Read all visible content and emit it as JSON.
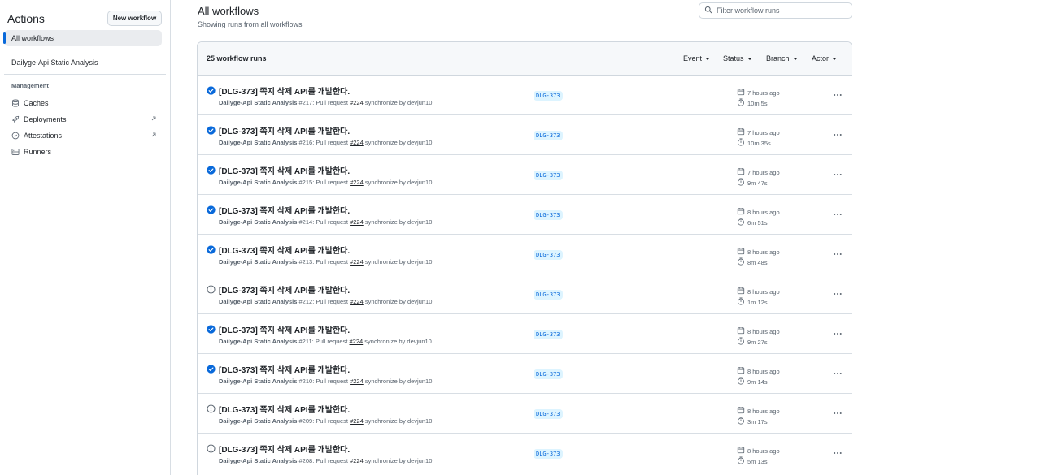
{
  "sidebar": {
    "title": "Actions",
    "new_workflow_label": "New workflow",
    "all_workflows_label": "All workflows",
    "workflow_item_label": "Dailyge-Api Static Analysis",
    "section_label": "Management",
    "management_items": [
      {
        "label": "Caches",
        "icon": "database-icon"
      },
      {
        "label": "Deployments",
        "icon": "rocket-icon",
        "external": true
      },
      {
        "label": "Attestations",
        "icon": "verified-icon",
        "external": true
      },
      {
        "label": "Runners",
        "icon": "server-icon"
      }
    ]
  },
  "main": {
    "title": "All workflows",
    "subtitle": "Showing runs from all workflows",
    "filter_placeholder": "Filter workflow runs"
  },
  "table": {
    "count_label": "25 workflow runs",
    "filters": [
      "Event",
      "Status",
      "Branch",
      "Actor"
    ]
  },
  "runs": [
    {
      "status": "success",
      "title": "[DLG-373] 쪽지 삭제 API를 개발한다.",
      "workflow": "Dailyge-Api Static Analysis",
      "run_no": "#217",
      "pr_prefix": ": Pull request ",
      "pr": "#224",
      "suffix": " synchronize by devjun10",
      "branch": "DLG-373",
      "time_ago": "7 hours ago",
      "duration": "10m 5s"
    },
    {
      "status": "success",
      "title": "[DLG-373] 쪽지 삭제 API를 개발한다.",
      "workflow": "Dailyge-Api Static Analysis",
      "run_no": "#216",
      "pr_prefix": ": Pull request ",
      "pr": "#224",
      "suffix": " synchronize by devjun10",
      "branch": "DLG-373",
      "time_ago": "7 hours ago",
      "duration": "10m 35s"
    },
    {
      "status": "success",
      "title": "[DLG-373] 쪽지 삭제 API를 개발한다.",
      "workflow": "Dailyge-Api Static Analysis",
      "run_no": "#215",
      "pr_prefix": ": Pull request ",
      "pr": "#224",
      "suffix": " synchronize by devjun10",
      "branch": "DLG-373",
      "time_ago": "7 hours ago",
      "duration": "9m 47s"
    },
    {
      "status": "success",
      "title": "[DLG-373] 쪽지 삭제 API를 개발한다.",
      "workflow": "Dailyge-Api Static Analysis",
      "run_no": "#214",
      "pr_prefix": ": Pull request ",
      "pr": "#224",
      "suffix": " synchronize by devjun10",
      "branch": "DLG-373",
      "time_ago": "8 hours ago",
      "duration": "6m 51s"
    },
    {
      "status": "success",
      "title": "[DLG-373] 쪽지 삭제 API를 개발한다.",
      "workflow": "Dailyge-Api Static Analysis",
      "run_no": "#213",
      "pr_prefix": ": Pull request ",
      "pr": "#224",
      "suffix": " synchronize by devjun10",
      "branch": "DLG-373",
      "time_ago": "8 hours ago",
      "duration": "8m 48s"
    },
    {
      "status": "warning",
      "title": "[DLG-373] 쪽지 삭제 API를 개발한다.",
      "workflow": "Dailyge-Api Static Analysis",
      "run_no": "#212",
      "pr_prefix": ": Pull request ",
      "pr": "#224",
      "suffix": " synchronize by devjun10",
      "branch": "DLG-373",
      "time_ago": "8 hours ago",
      "duration": "1m 12s"
    },
    {
      "status": "success",
      "title": "[DLG-373] 쪽지 삭제 API를 개발한다.",
      "workflow": "Dailyge-Api Static Analysis",
      "run_no": "#211",
      "pr_prefix": ": Pull request ",
      "pr": "#224",
      "suffix": " synchronize by devjun10",
      "branch": "DLG-373",
      "time_ago": "8 hours ago",
      "duration": "9m 27s"
    },
    {
      "status": "success",
      "title": "[DLG-373] 쪽지 삭제 API를 개발한다.",
      "workflow": "Dailyge-Api Static Analysis",
      "run_no": "#210",
      "pr_prefix": ": Pull request ",
      "pr": "#224",
      "suffix": " synchronize by devjun10",
      "branch": "DLG-373",
      "time_ago": "8 hours ago",
      "duration": "9m 14s"
    },
    {
      "status": "warning",
      "title": "[DLG-373] 쪽지 삭제 API를 개발한다.",
      "workflow": "Dailyge-Api Static Analysis",
      "run_no": "#209",
      "pr_prefix": ": Pull request ",
      "pr": "#224",
      "suffix": " synchronize by devjun10",
      "branch": "DLG-373",
      "time_ago": "8 hours ago",
      "duration": "3m 17s"
    },
    {
      "status": "warning",
      "title": "[DLG-373] 쪽지 삭제 API를 개발한다.",
      "workflow": "Dailyge-Api Static Analysis",
      "run_no": "#208",
      "pr_prefix": ": Pull request ",
      "pr": "#224",
      "suffix": " synchronize by devjun10",
      "branch": "DLG-373",
      "time_ago": "8 hours ago",
      "duration": "5m 13s"
    }
  ],
  "colors": {
    "accent": "#0969da",
    "success": "#0969da",
    "warning": "#59636e",
    "branch_bg": "#ddf4ff"
  }
}
